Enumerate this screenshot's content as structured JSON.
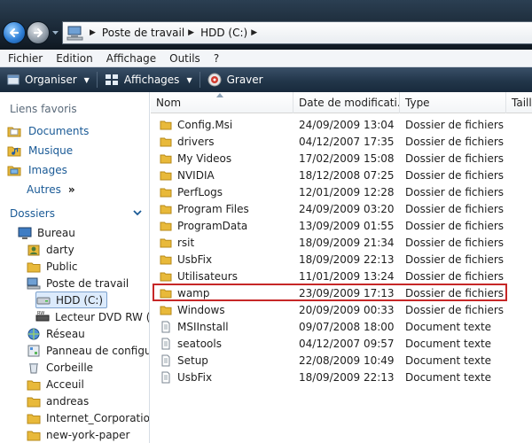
{
  "address": {
    "crumbs": [
      "Poste de travail",
      "HDD (C:)"
    ]
  },
  "menu": [
    "Fichier",
    "Edition",
    "Affichage",
    "Outils",
    "?"
  ],
  "commands": {
    "organiser": "Organiser",
    "affichages": "Affichages",
    "graver": "Graver"
  },
  "nav": {
    "favorites_title": "Liens favoris",
    "favorites": [
      "Documents",
      "Musique",
      "Images"
    ],
    "more": "Autres",
    "more_glyph": "»",
    "folders_title": "Dossiers",
    "tree": [
      "Bureau",
      "darty",
      "Public",
      "Poste de travail",
      "HDD (C:)",
      "Lecteur DVD RW (H:",
      "Réseau",
      "Panneau de configura",
      "Corbeille",
      "Acceuil",
      "andreas",
      "Internet_Corporation",
      "new-york-paper"
    ]
  },
  "columns": [
    "Nom",
    "Date de modificati...",
    "Type",
    "Taill"
  ],
  "files": [
    {
      "name": "Config.Msi",
      "date": "24/09/2009 13:04",
      "type": "Dossier de fichiers",
      "kind": "folder"
    },
    {
      "name": "drivers",
      "date": "04/12/2007 17:35",
      "type": "Dossier de fichiers",
      "kind": "folder"
    },
    {
      "name": "My Videos",
      "date": "17/02/2009 15:08",
      "type": "Dossier de fichiers",
      "kind": "folder"
    },
    {
      "name": "NVIDIA",
      "date": "18/12/2008 07:25",
      "type": "Dossier de fichiers",
      "kind": "folder"
    },
    {
      "name": "PerfLogs",
      "date": "12/01/2009 12:28",
      "type": "Dossier de fichiers",
      "kind": "folder"
    },
    {
      "name": "Program Files",
      "date": "24/09/2009 03:20",
      "type": "Dossier de fichiers",
      "kind": "folder"
    },
    {
      "name": "ProgramData",
      "date": "13/09/2009 01:55",
      "type": "Dossier de fichiers",
      "kind": "folder"
    },
    {
      "name": "rsit",
      "date": "18/09/2009 21:34",
      "type": "Dossier de fichiers",
      "kind": "folder"
    },
    {
      "name": "UsbFix",
      "date": "18/09/2009 22:13",
      "type": "Dossier de fichiers",
      "kind": "folder"
    },
    {
      "name": "Utilisateurs",
      "date": "11/01/2009 13:24",
      "type": "Dossier de fichiers",
      "kind": "folder"
    },
    {
      "name": "wamp",
      "date": "23/09/2009 17:13",
      "type": "Dossier de fichiers",
      "kind": "folder"
    },
    {
      "name": "Windows",
      "date": "20/09/2009 00:33",
      "type": "Dossier de fichiers",
      "kind": "folder"
    },
    {
      "name": "MSIInstall",
      "date": "09/07/2008 18:00",
      "type": "Document texte",
      "kind": "text"
    },
    {
      "name": "seatools",
      "date": "04/12/2007 09:57",
      "type": "Document texte",
      "kind": "text"
    },
    {
      "name": "Setup",
      "date": "22/08/2009 10:49",
      "type": "Document texte",
      "kind": "text"
    },
    {
      "name": "UsbFix",
      "date": "18/09/2009 22:13",
      "type": "Document texte",
      "kind": "text"
    }
  ],
  "colors": {
    "highlight_box": "#c62727",
    "folder": "#e8b93a",
    "link": "#1a5a96"
  }
}
